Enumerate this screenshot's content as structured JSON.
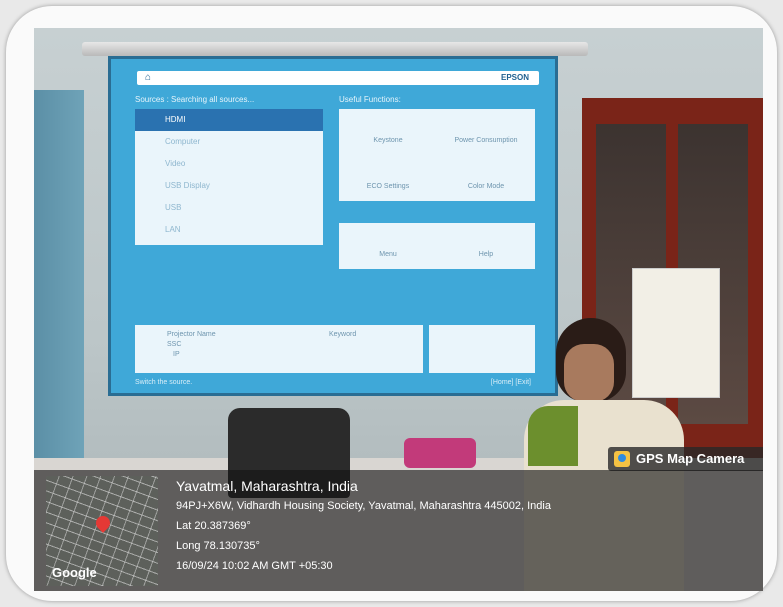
{
  "screen": {
    "brand": "EPSON",
    "sources_label": "Sources : Searching all sources...",
    "useful_label": "Useful Functions:",
    "sources": [
      "HDMI",
      "Computer",
      "Video",
      "USB Display",
      "USB",
      "LAN"
    ],
    "functions": [
      "Keystone",
      "Power Consumption",
      "ECO Settings",
      "Color Mode",
      "Menu",
      "Help"
    ],
    "projector_name_label": "Projector Name",
    "projector_name": "SSC",
    "ip_label": "IP",
    "keyword_label": "Keyword",
    "status_text": "Switch the source.",
    "status_right": "[Home] [Exit]"
  },
  "overlay": {
    "app_name": "GPS Map Camera",
    "location": "Yavatmal, Maharashtra, India",
    "address": "94PJ+X6W, Vidhardh Housing Society, Yavatmal, Maharashtra 445002, India",
    "lat": "Lat 20.387369°",
    "long": "Long 78.130735°",
    "datetime": "16/09/24 10:02 AM GMT +05:30",
    "map_brand": "Google"
  }
}
